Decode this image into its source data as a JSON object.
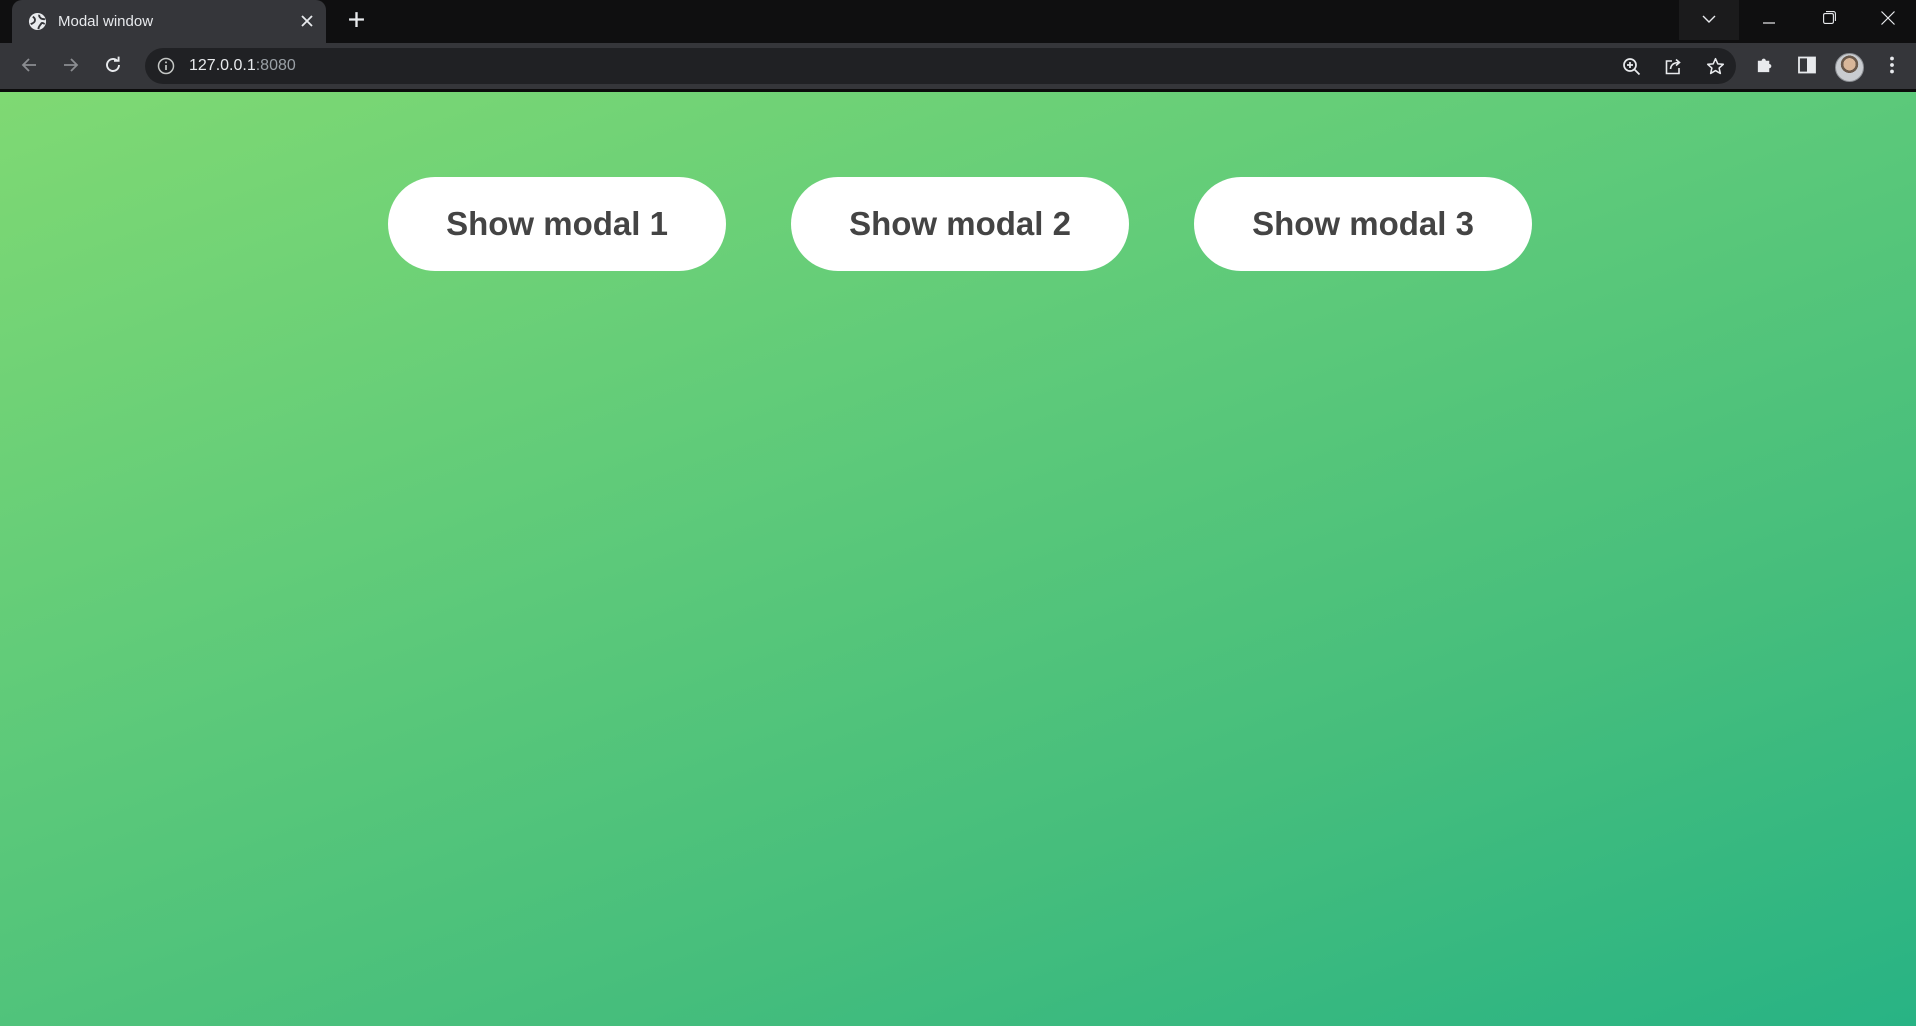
{
  "browser": {
    "tab": {
      "title": "Modal window"
    },
    "address_bar": {
      "host": "127.0.0.1",
      "port": ":8080"
    }
  },
  "icons": {
    "favicon": "globe-icon",
    "tab_close": "close-icon",
    "new_tab": "plus-icon",
    "tab_search": "chevron-down-icon",
    "minimize": "minimize-icon",
    "restore": "restore-icon",
    "window_close": "close-icon",
    "back": "arrow-left-icon",
    "forward": "arrow-right-icon",
    "reload": "reload-icon",
    "site_info": "info-icon",
    "zoom": "zoom-icon",
    "share": "share-icon",
    "bookmark": "star-icon",
    "extensions": "puzzle-icon",
    "side_panel": "side-panel-icon",
    "menu": "kebab-menu-icon"
  },
  "page": {
    "buttons": [
      {
        "label": "Show modal 1"
      },
      {
        "label": "Show modal 2"
      },
      {
        "label": "Show modal 3"
      }
    ],
    "background_gradient": [
      "#7fd973",
      "#28b384"
    ],
    "button_text_color": "#444444"
  }
}
